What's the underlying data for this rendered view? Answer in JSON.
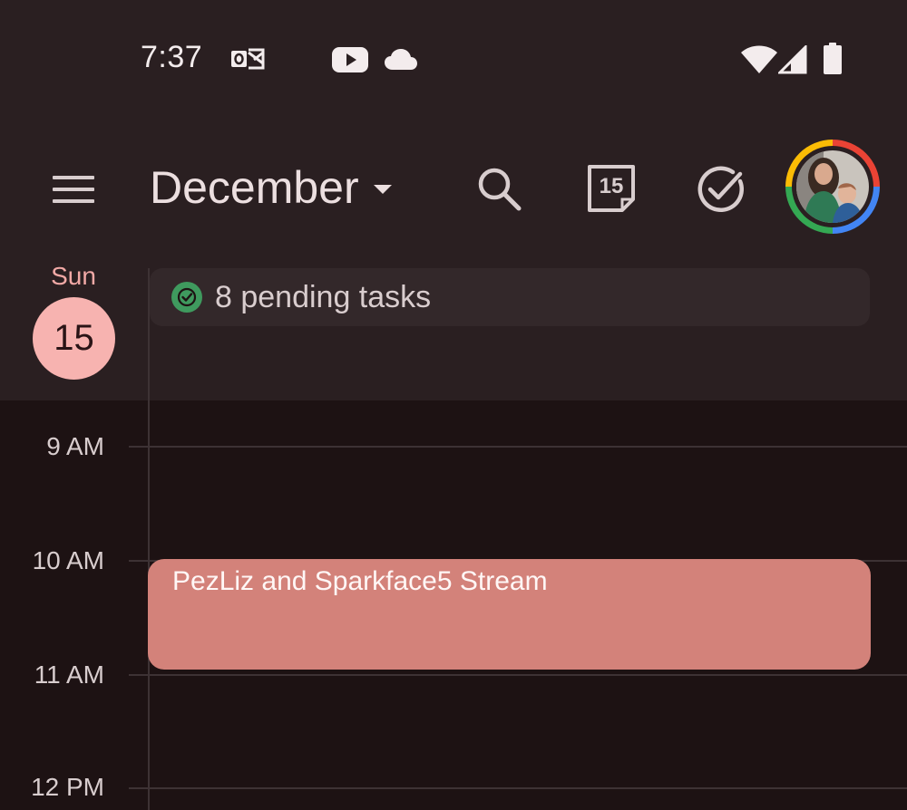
{
  "status_bar": {
    "time": "7:37",
    "icons": [
      "outlook-icon",
      "youtube-icon",
      "cloud-icon"
    ],
    "right_icons": [
      "wifi-icon",
      "signal-icon",
      "battery-icon"
    ]
  },
  "header": {
    "month": "December",
    "icons": [
      "menu-icon",
      "search-icon",
      "calendar-today-icon",
      "tasks-check-icon"
    ],
    "today_badge": "15"
  },
  "day": {
    "name": "Sun",
    "number": "15"
  },
  "tasks_chip": {
    "label": "8 pending tasks"
  },
  "hours": [
    "9 AM",
    "10 AM",
    "11 AM",
    "12 PM"
  ],
  "events": [
    {
      "title": "PezLiz and Sparkface5 Stream",
      "color": "#d3827a"
    }
  ],
  "colors": {
    "accent": "#f7b3b0",
    "event": "#d3827a",
    "task_check": "#3f9a5e",
    "background": "#1d1213",
    "header_band": "#2a1f21"
  }
}
